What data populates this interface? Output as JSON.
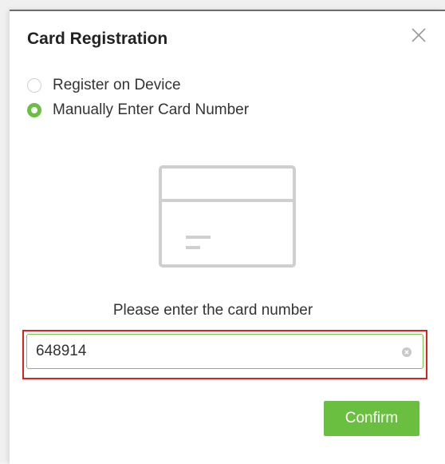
{
  "dialog": {
    "title": "Card Registration",
    "close_icon": "close-icon"
  },
  "options": [
    {
      "label": "Register on Device",
      "selected": false
    },
    {
      "label": "Manually Enter Card Number",
      "selected": true
    }
  ],
  "illustration_icon": "card-icon",
  "prompt": "Please enter the card number",
  "card_number_input": {
    "value": "648914",
    "clear_icon": "clear-icon"
  },
  "confirm_label": "Confirm",
  "colors": {
    "accent": "#6abf40",
    "highlight": "#e02020",
    "input_border": "#76c34e"
  }
}
